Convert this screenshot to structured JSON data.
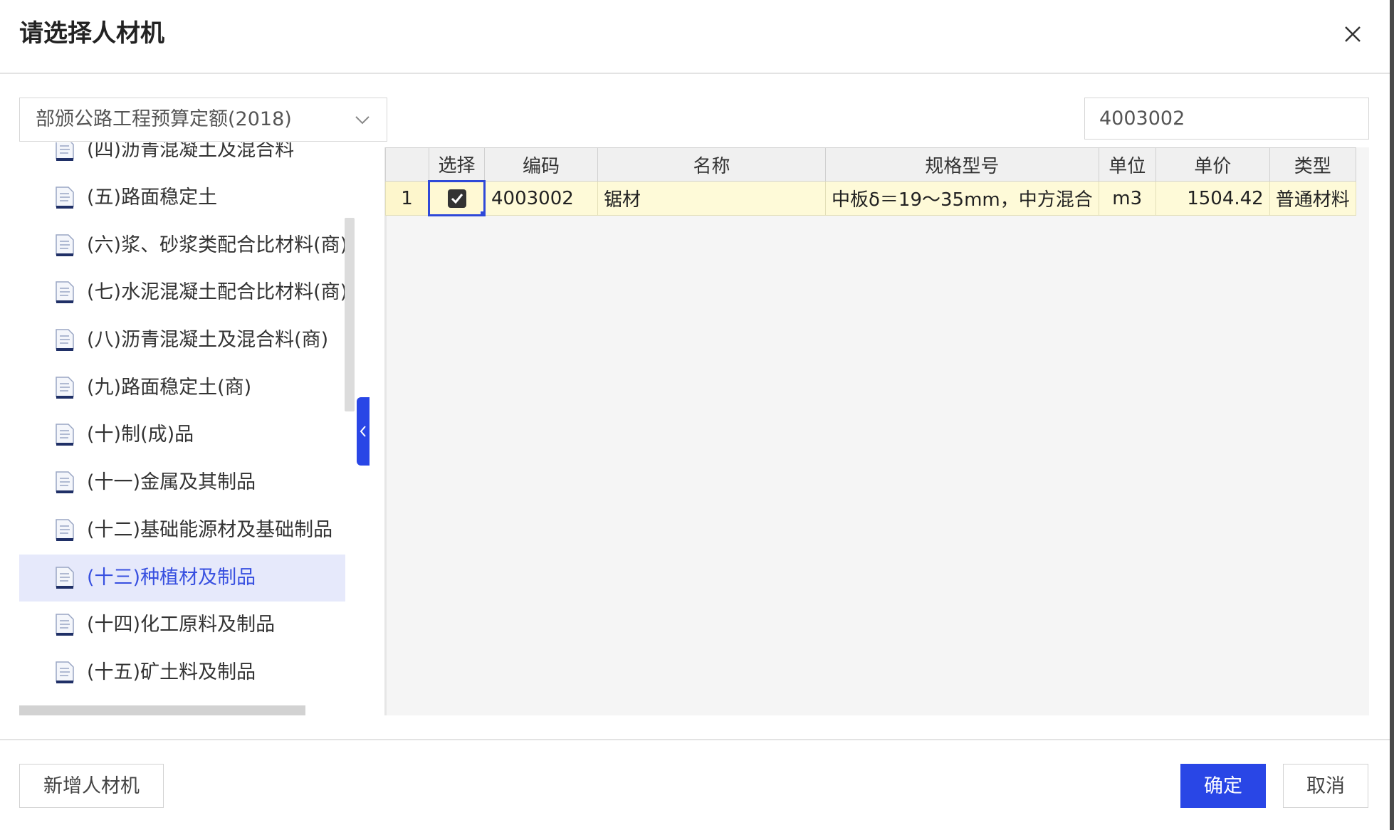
{
  "dialog": {
    "title": "请选择人材机",
    "close_icon": "close-icon"
  },
  "filter": {
    "quota_select": "部颁公路工程预算定额(2018)",
    "search_value": "4003002"
  },
  "tree": {
    "items": [
      {
        "label": "(四)沥青混凝土及混合料",
        "selected": false
      },
      {
        "label": "(五)路面稳定土",
        "selected": false
      },
      {
        "label": "(六)浆、砂浆类配合比材料(商)",
        "selected": false
      },
      {
        "label": "(七)水泥混凝土配合比材料(商)",
        "selected": false
      },
      {
        "label": "(八)沥青混凝土及混合料(商)",
        "selected": false
      },
      {
        "label": "(九)路面稳定土(商)",
        "selected": false
      },
      {
        "label": "(十)制(成)品",
        "selected": false
      },
      {
        "label": "(十一)金属及其制品",
        "selected": false
      },
      {
        "label": "(十二)基础能源材及基础制品",
        "selected": false
      },
      {
        "label": "(十三)种植材及制品",
        "selected": true
      },
      {
        "label": "(十四)化工原料及制品",
        "selected": false
      },
      {
        "label": "(十五)矿土料及制品",
        "selected": false
      }
    ]
  },
  "grid": {
    "columns": [
      "选择",
      "编码",
      "名称",
      "规格型号",
      "单位",
      "单价",
      "类型"
    ],
    "rows": [
      {
        "index": "1",
        "checked": true,
        "code": "4003002",
        "name": "锯材",
        "spec": "中板δ＝19～35mm，中方混合",
        "unit": "m3",
        "price": "1504.42",
        "type": "普通材料"
      }
    ]
  },
  "footer": {
    "add_label": "新增人材机",
    "ok_label": "确定",
    "cancel_label": "取消"
  },
  "colors": {
    "accent": "#2946e6",
    "selected_row": "#e6e9fb",
    "grid_row": "#fefad8"
  }
}
